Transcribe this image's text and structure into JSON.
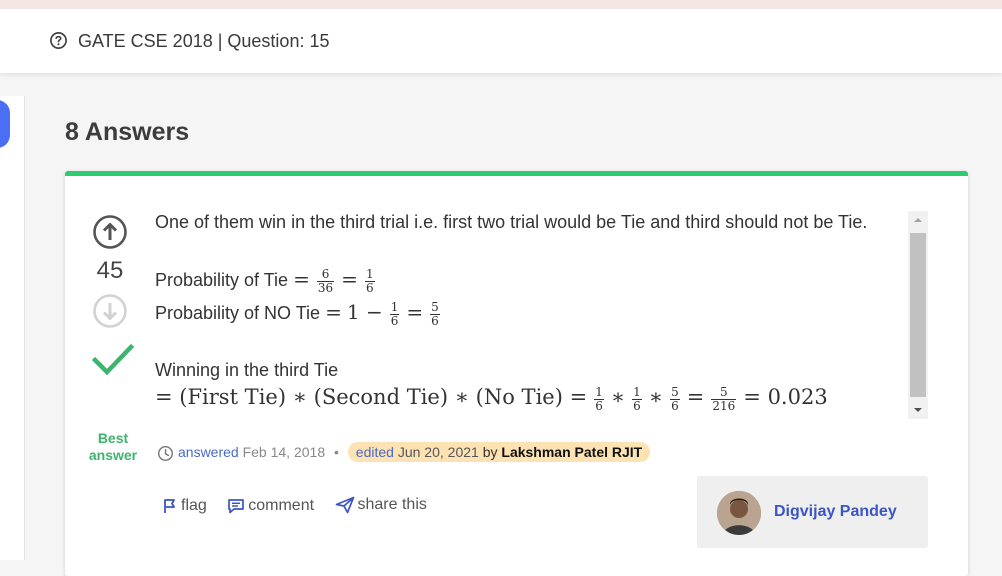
{
  "question": {
    "title": "GATE CSE 2018 | Question: 15"
  },
  "answers_heading": "8 Answers",
  "answer": {
    "votes": "45",
    "best_label_line1": "Best",
    "best_label_line2": "answer",
    "line1": "One of them win in the third trial i.e. first two trial would be Tie and third should not be Tie.",
    "prob_tie_label": "Probability of Tie",
    "prob_no_tie_label": "Probability of NO Tie",
    "winning_label": "Winning in the third Tie",
    "math": {
      "eq": "=",
      "frac_6_36_num": "6",
      "frac_6_36_den": "36",
      "frac_1_6_num": "1",
      "frac_1_6_den": "6",
      "frac_5_6_num": "5",
      "frac_5_6_den": "6",
      "frac_5_216_num": "5",
      "frac_5_216_den": "216",
      "one_minus": "1 −",
      "expr_lhs": "= (First Tie) ∗ (Second Tie) ∗ (No Tie) =",
      "star": "∗",
      "result": "= 0.023"
    },
    "meta": {
      "answered": "answered",
      "answered_date": "Feb 14, 2018",
      "separator": "•",
      "edited": "edited",
      "edited_date": "Jun 20, 2021",
      "by": "by",
      "editor": "Lakshman Patel RJIT"
    },
    "actions": {
      "flag": "flag",
      "comment": "comment",
      "share": "share this"
    },
    "author": "Digvijay Pandey"
  },
  "colors": {
    "accent_green": "#2ecc71",
    "link_blue": "#4a6ac4",
    "best_green": "#3db46d",
    "edited_bg": "#fde2b4"
  },
  "icons": [
    "question-circle-icon",
    "upvote-icon",
    "downvote-icon",
    "check-icon",
    "clock-icon",
    "flag-icon",
    "comment-icon",
    "share-icon"
  ]
}
